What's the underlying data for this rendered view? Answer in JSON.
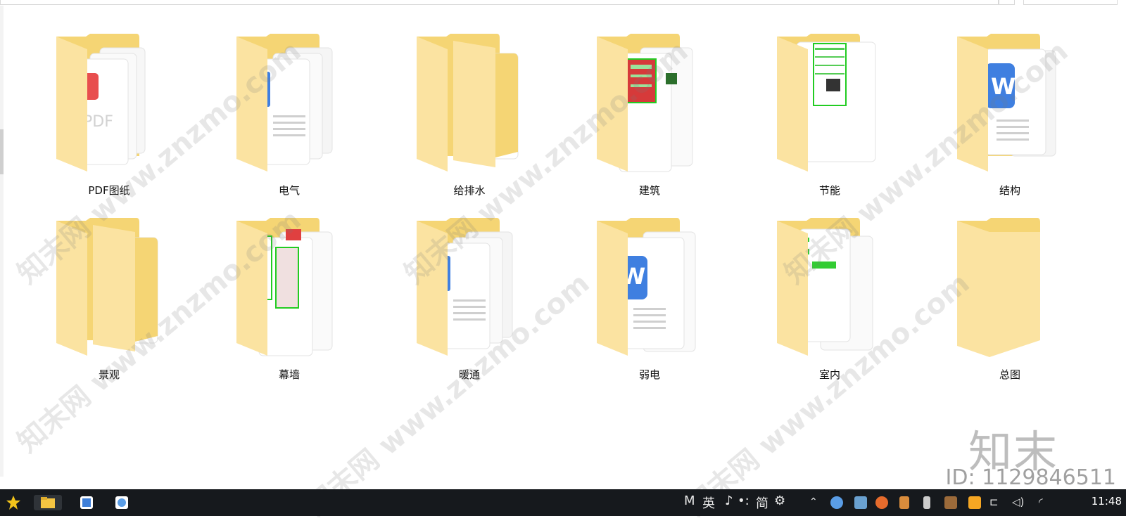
{
  "folders": [
    {
      "name": "PDF图纸",
      "preview": "pdf"
    },
    {
      "name": "电气",
      "preview": "word-stack"
    },
    {
      "name": "给排水",
      "preview": "photo"
    },
    {
      "name": "建筑",
      "preview": "cad"
    },
    {
      "name": "节能",
      "preview": "table-sheet"
    },
    {
      "name": "结构",
      "preview": "word"
    },
    {
      "name": "景观",
      "preview": "photo"
    },
    {
      "name": "幕墙",
      "preview": "cad-table"
    },
    {
      "name": "暖通",
      "preview": "word-stack"
    },
    {
      "name": "弱电",
      "preview": "word-blue"
    },
    {
      "name": "室内",
      "preview": "cad-small"
    },
    {
      "name": "总图",
      "preview": "empty"
    }
  ],
  "watermark": {
    "text": "知末网 www.znzmo.com",
    "logo": "知末",
    "id": "ID: 1129846511"
  },
  "taskbar": {
    "tray_items": [
      "M",
      "英",
      "♪",
      "•:",
      "简",
      "⚙"
    ],
    "clock": "11:48"
  },
  "colors": {
    "folder_back": "#f5d574",
    "folder_front": "#fbe3a1",
    "taskbar": "#16191d",
    "word_blue": "#3f7fe0",
    "pdf_red": "#e84e4e",
    "cad_green": "#22cc22"
  }
}
